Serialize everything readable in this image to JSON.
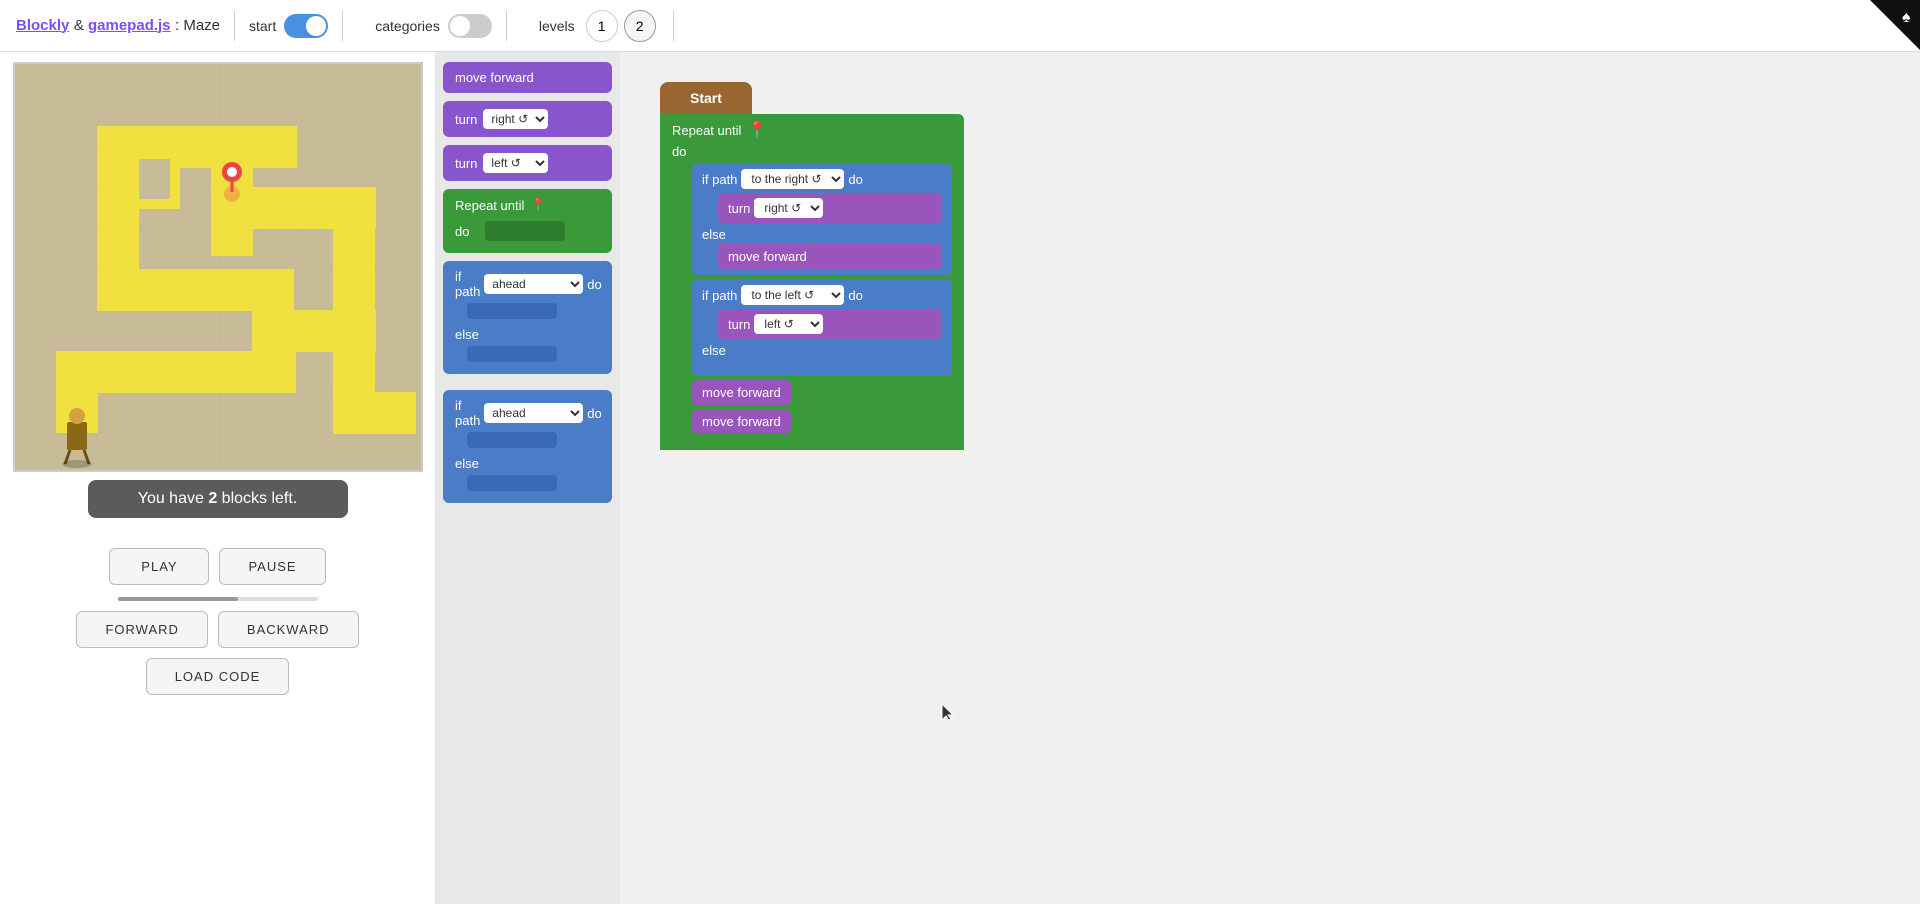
{
  "header": {
    "blockly_label": "Blockly",
    "ampersand": " & ",
    "gamepad_label": "gamepad.js",
    "colon_maze": ": Maze",
    "start_label": "start",
    "categories_label": "categories",
    "levels_label": "levels",
    "level1": "1",
    "level2": "2"
  },
  "status": {
    "text": "You have ",
    "count": "2",
    "suffix": " blocks left."
  },
  "controls": {
    "play": "PLAY",
    "pause": "PAUSE",
    "forward": "FORWARD",
    "backward": "BACKWARD",
    "load_code": "LOAD CODE"
  },
  "toolbox": {
    "move_forward": "move forward",
    "turn_right_label": "turn",
    "turn_right_val": "right ↺",
    "turn_left_label": "turn",
    "turn_left_val": "left ↺",
    "repeat_label": "Repeat until",
    "repeat_do": "do",
    "if_path_label1": "if path",
    "if_path_val1": "ahead",
    "if_path_do1": "do",
    "if_path_else1": "else",
    "if_path_label2": "if path",
    "if_path_val2": "ahead",
    "if_path_do2": "do",
    "if_path_else2": "else"
  },
  "workspace": {
    "start_label": "Start",
    "repeat_label": "Repeat until",
    "do_label": "do",
    "if_path_right": "if path",
    "to_the_right": "to the right ↺",
    "do1": "do",
    "else1": "else",
    "turn_right": "turn",
    "right_val": "right ↺",
    "move_forward1": "move forward",
    "if_path_left": "if path",
    "to_the_left": "to the left ↺",
    "do2": "do",
    "else2": "else",
    "turn_left": "turn",
    "left_val": "left ↺",
    "move_forward2": "move forward",
    "move_forward3": "move forward"
  }
}
